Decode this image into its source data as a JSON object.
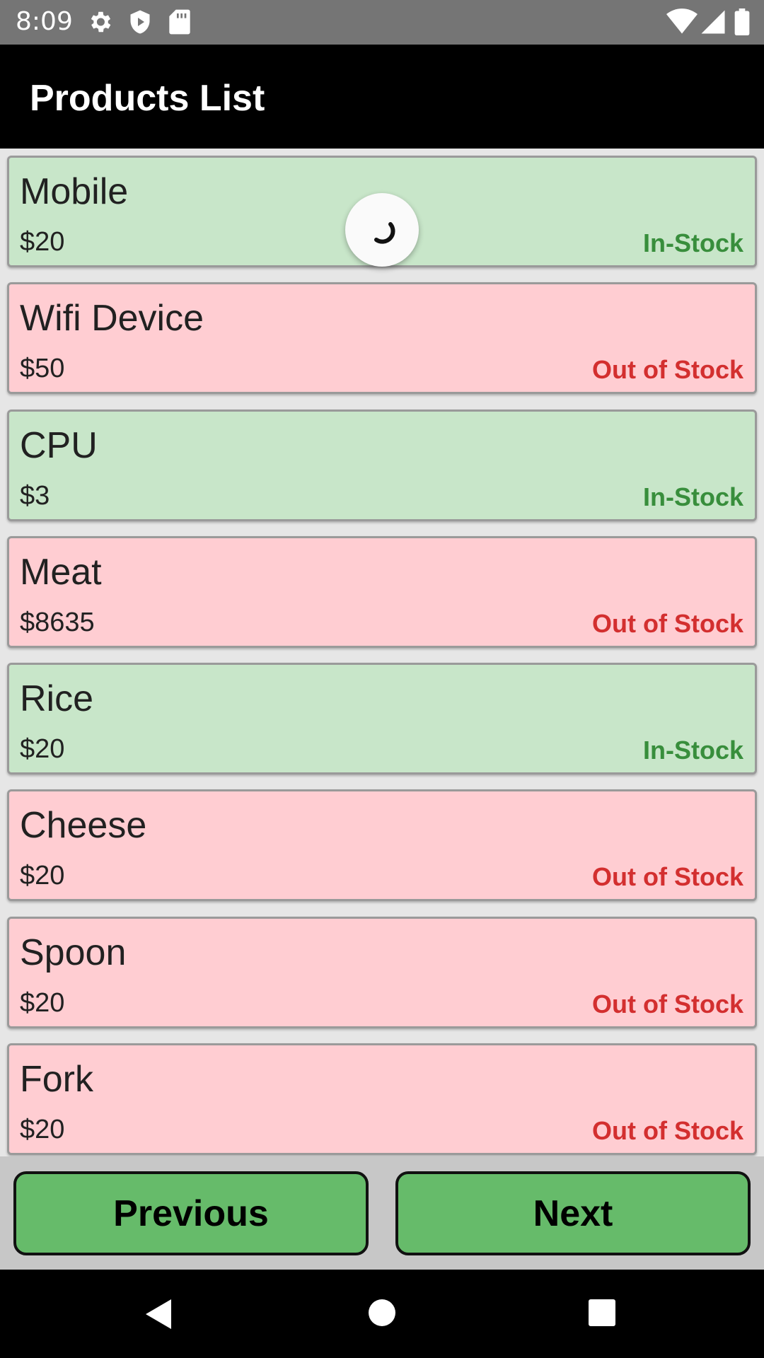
{
  "status_bar": {
    "time": "8:09",
    "icons": [
      "settings-icon",
      "shield-icon",
      "sd-card-icon",
      "wifi-icon",
      "signal-icon",
      "battery-icon"
    ]
  },
  "app_bar": {
    "title": "Products List"
  },
  "products": [
    {
      "name": "Mobile",
      "price": "$20",
      "status": "In-Stock"
    },
    {
      "name": "Wifi Device",
      "price": "$50",
      "status": "Out of Stock"
    },
    {
      "name": "CPU",
      "price": "$3",
      "status": "In-Stock"
    },
    {
      "name": "Meat",
      "price": "$8635",
      "status": "Out of Stock"
    },
    {
      "name": "Rice",
      "price": "$20",
      "status": "In-Stock"
    },
    {
      "name": "Cheese",
      "price": "$20",
      "status": "Out of Stock"
    },
    {
      "name": "Spoon",
      "price": "$20",
      "status": "Out of Stock"
    },
    {
      "name": "Fork",
      "price": "$20",
      "status": "Out of Stock"
    }
  ],
  "buttons": {
    "previous_label": "Previous",
    "next_label": "Next"
  },
  "colors": {
    "in_stock_bg": "#c8e6c9",
    "out_of_stock_bg": "#ffcdd2",
    "in_stock_text": "#388e3c",
    "out_of_stock_text": "#d32f2f",
    "button_bg": "#66bb6a"
  },
  "system_nav": {
    "icons": [
      "back-icon",
      "home-icon",
      "recents-icon"
    ]
  }
}
